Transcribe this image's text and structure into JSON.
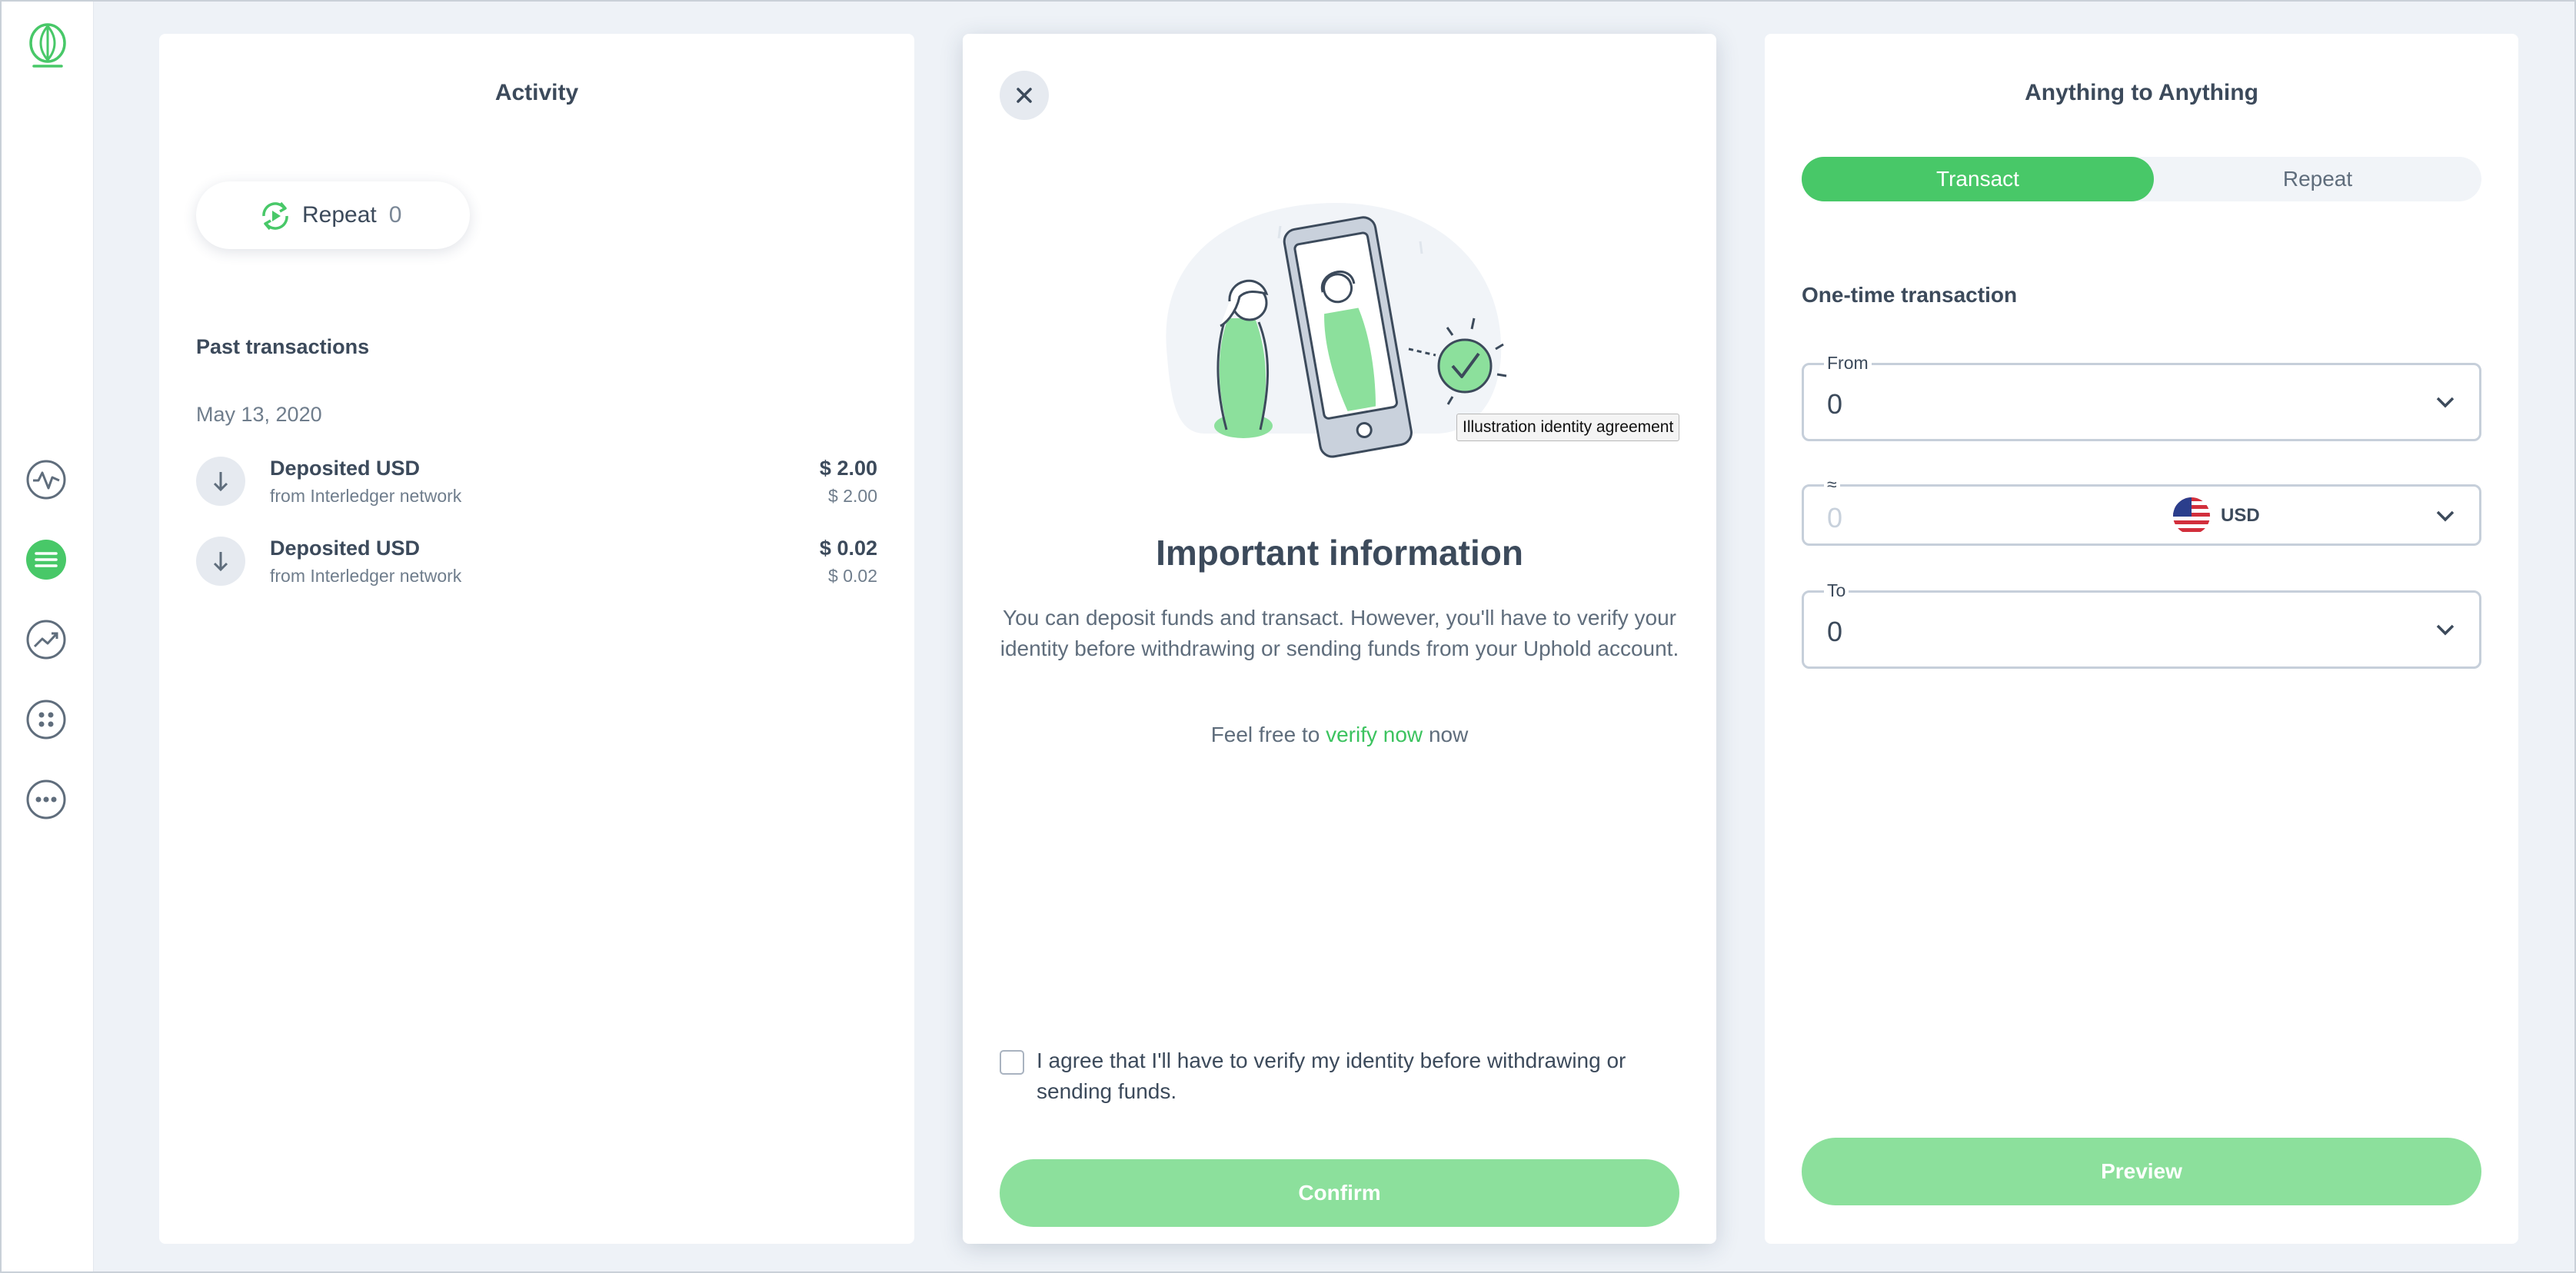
{
  "activity": {
    "title": "Activity",
    "repeat_label": "Repeat",
    "repeat_count": "0",
    "past_transactions_label": "Past transactions",
    "date": "May 13, 2020",
    "transactions": [
      {
        "title": "Deposited USD",
        "subtitle": "from Interledger network",
        "amount": "$ 2.00",
        "amount_secondary": "$ 2.00"
      },
      {
        "title": "Deposited USD",
        "subtitle": "from Interledger network",
        "amount": "$ 0.02",
        "amount_secondary": "$ 0.02"
      }
    ]
  },
  "modal": {
    "illustration_tooltip": "Illustration identity agreement",
    "title": "Important information",
    "body": "You can deposit funds and transact. However, you'll have to verify your identity before withdrawing or sending funds from your Uphold account.",
    "verify_prefix": "Feel free to",
    "verify_link": "verify now",
    "verify_suffix": "now",
    "agree_text": "I agree that I'll have to verify my identity before withdrawing or sending funds.",
    "confirm_label": "Confirm"
  },
  "transact": {
    "title": "Anything to Anything",
    "tabs": [
      "Transact",
      "Repeat"
    ],
    "subtitle": "One-time transaction",
    "from_label": "From",
    "from_value": "0",
    "approx_label": "≈",
    "approx_value": "0",
    "approx_currency": "USD",
    "to_label": "To",
    "to_value": "0",
    "preview_label": "Preview"
  },
  "colors": {
    "accent": "#48c868",
    "accent_disabled": "#8ce09c",
    "text": "#3c4a5b",
    "muted": "#6f7d8c",
    "background": "#eef2f7"
  },
  "icons": {
    "sidebar": [
      "uphold-logo-icon",
      "activity-pulse-icon",
      "transactions-list-icon",
      "trend-chart-icon",
      "apps-grid-icon",
      "more-dots-icon"
    ]
  }
}
